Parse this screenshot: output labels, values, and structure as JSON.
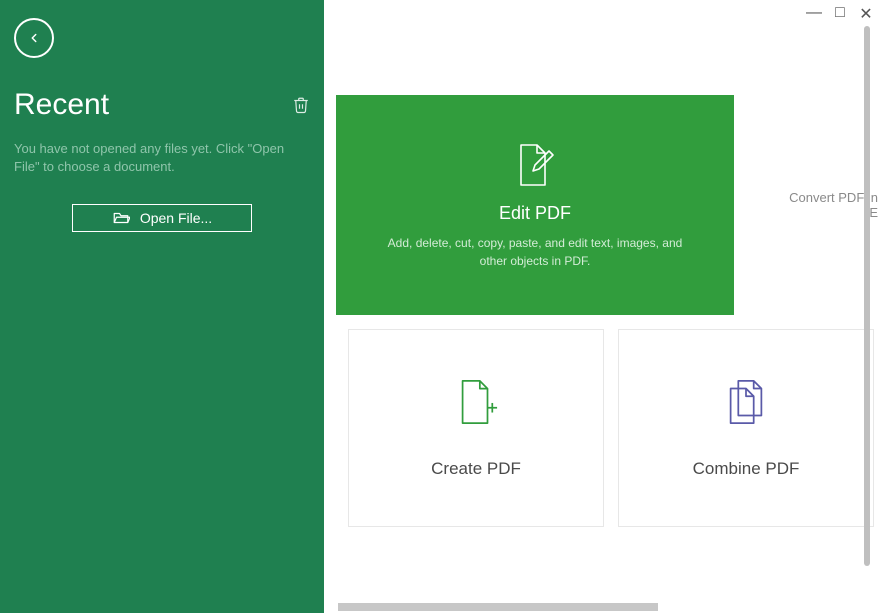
{
  "sidebar": {
    "recent_title": "Recent",
    "empty_message": "You have not opened any files yet. Click \"Open File\" to choose a document.",
    "open_file_label": "Open File..."
  },
  "hero": {
    "title": "Edit PDF",
    "description": "Add, delete, cut, copy, paste, and edit text, images, and other objects in PDF."
  },
  "partial": {
    "line1": "Convert PDF in",
    "line2": "E"
  },
  "cards": {
    "create": "Create PDF",
    "combine": "Combine PDF"
  },
  "window_controls": {
    "minimize": "—",
    "maximize": "□",
    "close": "✕"
  }
}
